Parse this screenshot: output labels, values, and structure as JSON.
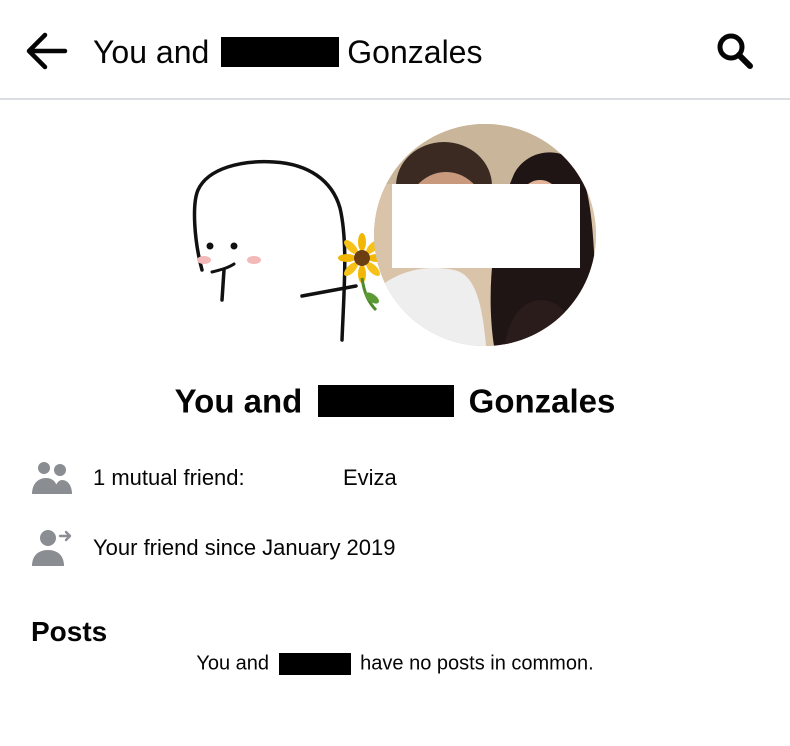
{
  "header": {
    "back_icon": "arrow-left-icon",
    "title_prefix": "You and",
    "title_suffix": "Gonzales",
    "search_icon": "search-icon"
  },
  "profile": {
    "title_prefix": "You and",
    "title_suffix": "Gonzales"
  },
  "info": {
    "mutual_label": "1 mutual friend:",
    "mutual_name": "Eviza",
    "mutual_icon": "friends-icon",
    "friend_since": "Your friend since January 2019",
    "friend_since_icon": "friend-since-icon"
  },
  "posts": {
    "heading": "Posts",
    "empty_prefix": "You and",
    "empty_suffix": "have no posts in common."
  }
}
